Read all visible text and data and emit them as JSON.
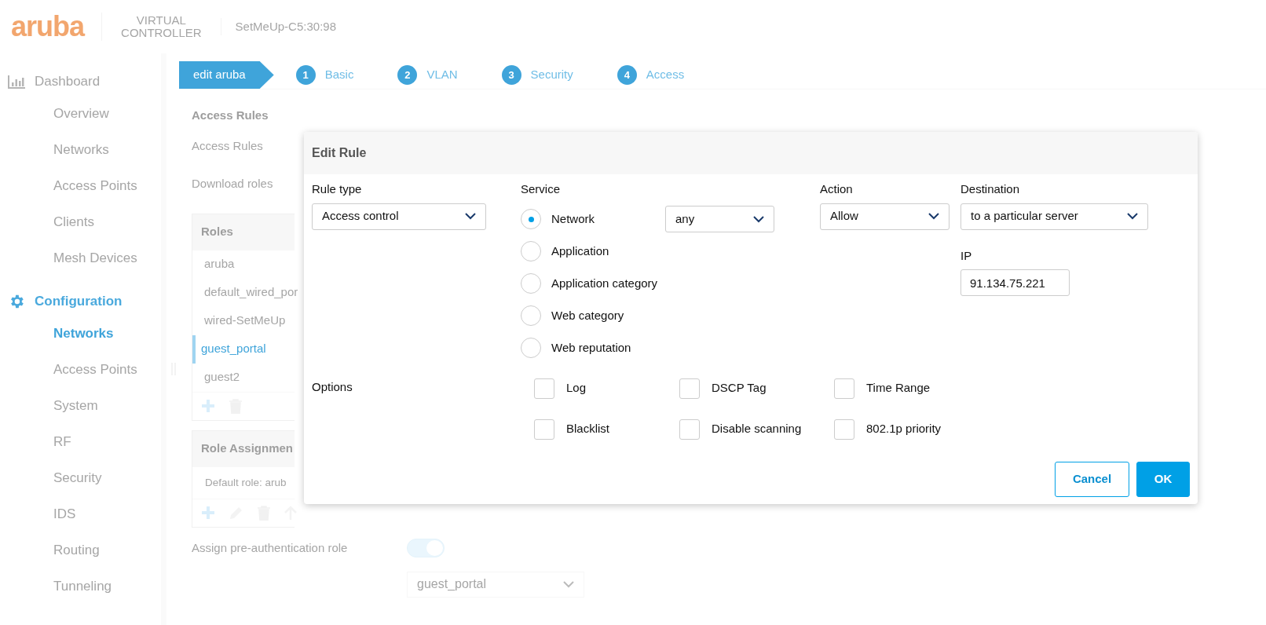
{
  "header": {
    "logo": "aruba",
    "product": [
      "VIRTUAL",
      "CONTROLLER"
    ],
    "device": "SetMeUp-C5:30:98"
  },
  "sidebar": [
    {
      "title": "Dashboard",
      "selected": false,
      "items": [
        {
          "label": "Overview",
          "selected": false
        },
        {
          "label": "Networks",
          "selected": false
        },
        {
          "label": "Access Points",
          "selected": false
        },
        {
          "label": "Clients",
          "selected": false
        },
        {
          "label": "Mesh Devices",
          "selected": false
        }
      ]
    },
    {
      "title": "Configuration",
      "selected": true,
      "items": [
        {
          "label": "Networks",
          "selected": true
        },
        {
          "label": "Access Points",
          "selected": false
        },
        {
          "label": "System",
          "selected": false
        },
        {
          "label": "RF",
          "selected": false
        },
        {
          "label": "Security",
          "selected": false
        },
        {
          "label": "IDS",
          "selected": false
        },
        {
          "label": "Routing",
          "selected": false
        },
        {
          "label": "Tunneling",
          "selected": false
        }
      ]
    }
  ],
  "wizard": {
    "current": "edit aruba",
    "steps": [
      {
        "number": "1",
        "label": "Basic"
      },
      {
        "number": "2",
        "label": "VLAN"
      },
      {
        "number": "3",
        "label": "Security"
      },
      {
        "number": "4",
        "label": "Access"
      }
    ]
  },
  "content": {
    "title": "Access Rules",
    "rows": [
      "Access Rules",
      "Download roles"
    ],
    "roles": {
      "header": "Roles",
      "items": [
        {
          "label": "aruba",
          "selected": false
        },
        {
          "label": "default_wired_por",
          "selected": false
        },
        {
          "label": "wired-SetMeUp",
          "selected": false
        },
        {
          "label": "guest_portal",
          "selected": true
        },
        {
          "label": "guest2",
          "selected": false
        }
      ]
    },
    "role_assignment": {
      "header": "Role Assignmen",
      "items": [
        "Default role: arub"
      ]
    },
    "pre_auth": {
      "label": "Assign pre-authentication role",
      "on": true,
      "role": "guest_portal"
    }
  },
  "modal": {
    "title": "Edit Rule",
    "rule_type": {
      "label": "Rule type",
      "value": "Access control"
    },
    "service": {
      "label": "Service",
      "select": "any",
      "options": [
        {
          "label": "Network",
          "selected": true
        },
        {
          "label": "Application",
          "selected": false
        },
        {
          "label": "Application category",
          "selected": false
        },
        {
          "label": "Web category",
          "selected": false
        },
        {
          "label": "Web reputation",
          "selected": false
        }
      ]
    },
    "action": {
      "label": "Action",
      "value": "Allow"
    },
    "destination": {
      "label": "Destination",
      "value": "to a particular server"
    },
    "ip": {
      "label": "IP",
      "value": "91.134.75.221"
    },
    "options": {
      "label": "Options",
      "items": [
        {
          "label": "Log",
          "checked": false
        },
        {
          "label": "DSCP Tag",
          "checked": false
        },
        {
          "label": "Time Range",
          "checked": false
        },
        {
          "label": "Blacklist",
          "checked": false
        },
        {
          "label": "Disable scanning",
          "checked": false
        },
        {
          "label": "802.1p priority",
          "checked": false
        }
      ]
    },
    "buttons": [
      {
        "label": "Cancel",
        "kind": "secondary"
      },
      {
        "label": "OK",
        "kind": "primary"
      }
    ]
  }
}
